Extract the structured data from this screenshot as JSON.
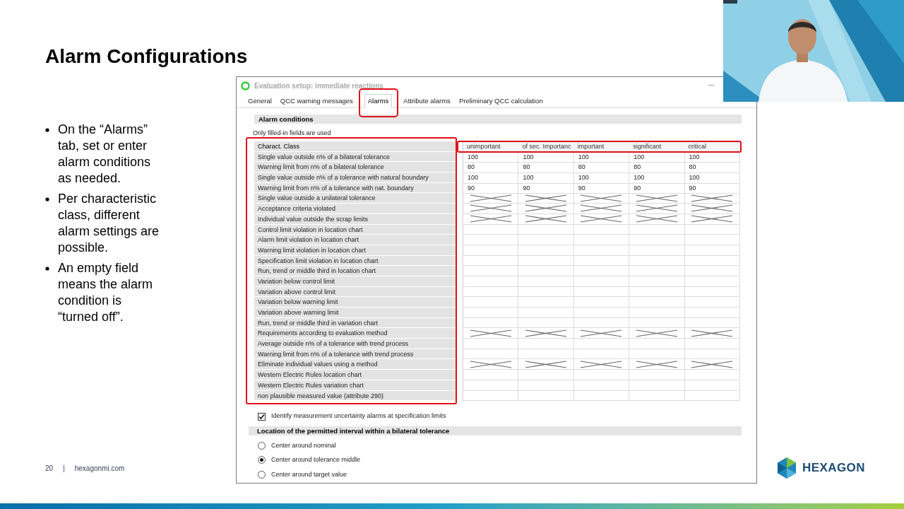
{
  "slide": {
    "title": "Alarm Configurations",
    "bullets": [
      "On the “Alarms” tab, set or enter alarm conditions as needed.",
      "Per characteristic class, different alarm settings are possible.",
      "An empty field means the alarm condition is “turned off”."
    ],
    "page_number": "20",
    "separator": "|",
    "website": "hexagonmi.com",
    "logo_text": "HEXAGON"
  },
  "window": {
    "title": "Evaluation setup: immediate reactions",
    "tabs": [
      {
        "label": "General",
        "selected": false,
        "highlighted": false
      },
      {
        "label": "QCC warning messages",
        "selected": false,
        "highlighted": false
      },
      {
        "label": "Alarms",
        "selected": true,
        "highlighted": true
      },
      {
        "label": "Attribute alarms",
        "selected": false,
        "highlighted": false
      },
      {
        "label": "Preliminary QCC calculation",
        "selected": false,
        "highlighted": false
      }
    ],
    "section_title": "Alarm conditions",
    "note": "Only filled-in fields are used",
    "table": {
      "labels_highlighted": true,
      "header_highlighted": true,
      "corner": "Charact. Class",
      "columns": [
        "unimportant",
        "of sec. Importanc",
        "important",
        "significant",
        "critical"
      ],
      "rows": [
        {
          "label": "Single value outside n% of a bilateral  tolerance",
          "cells": [
            {
              "kind": "value",
              "text": "100"
            },
            {
              "kind": "value",
              "text": "100"
            },
            {
              "kind": "value",
              "text": "100"
            },
            {
              "kind": "value",
              "text": "100"
            },
            {
              "kind": "value",
              "text": "100"
            }
          ]
        },
        {
          "label": "Warning limit from n% of a bilateral tolerance",
          "cells": [
            {
              "kind": "value",
              "text": "80"
            },
            {
              "kind": "value",
              "text": "80"
            },
            {
              "kind": "value",
              "text": "80"
            },
            {
              "kind": "value",
              "text": "80"
            },
            {
              "kind": "value",
              "text": "80"
            }
          ]
        },
        {
          "label": "Single value outside n% of a tolerance with natural boundary",
          "cells": [
            {
              "kind": "value",
              "text": "100"
            },
            {
              "kind": "value",
              "text": "100"
            },
            {
              "kind": "value",
              "text": "100"
            },
            {
              "kind": "value",
              "text": "100"
            },
            {
              "kind": "value",
              "text": "100"
            }
          ]
        },
        {
          "label": "Warning limit from n% of a tolerance with nat. boundary",
          "cells": [
            {
              "kind": "value",
              "text": "90"
            },
            {
              "kind": "value",
              "text": "90"
            },
            {
              "kind": "value",
              "text": "90"
            },
            {
              "kind": "value",
              "text": "90"
            },
            {
              "kind": "value",
              "text": "90"
            }
          ]
        },
        {
          "label": "Single value outside a unilateral tolerance",
          "cells": [
            {
              "kind": "crossed"
            },
            {
              "kind": "crossed"
            },
            {
              "kind": "crossed"
            },
            {
              "kind": "crossed"
            },
            {
              "kind": "crossed"
            }
          ]
        },
        {
          "label": "Acceptance criteria violated",
          "cells": [
            {
              "kind": "crossed"
            },
            {
              "kind": "crossed"
            },
            {
              "kind": "crossed"
            },
            {
              "kind": "crossed"
            },
            {
              "kind": "crossed"
            }
          ]
        },
        {
          "label": "Individual value outside the scrap limits",
          "cells": [
            {
              "kind": "crossed"
            },
            {
              "kind": "crossed"
            },
            {
              "kind": "crossed"
            },
            {
              "kind": "crossed"
            },
            {
              "kind": "crossed"
            }
          ]
        },
        {
          "label": "Control limit violation in location chart",
          "cells": [
            {
              "kind": "empty"
            },
            {
              "kind": "empty"
            },
            {
              "kind": "empty"
            },
            {
              "kind": "empty"
            },
            {
              "kind": "empty"
            }
          ]
        },
        {
          "label": "Alarm limit violation in location chart",
          "cells": [
            {
              "kind": "empty"
            },
            {
              "kind": "empty"
            },
            {
              "kind": "empty"
            },
            {
              "kind": "empty"
            },
            {
              "kind": "empty"
            }
          ]
        },
        {
          "label": "Warning  limit violation in location chart",
          "cells": [
            {
              "kind": "empty"
            },
            {
              "kind": "empty"
            },
            {
              "kind": "empty"
            },
            {
              "kind": "empty"
            },
            {
              "kind": "empty"
            }
          ]
        },
        {
          "label": "Specification limit violation in location chart",
          "cells": [
            {
              "kind": "empty"
            },
            {
              "kind": "empty"
            },
            {
              "kind": "empty"
            },
            {
              "kind": "empty"
            },
            {
              "kind": "empty"
            }
          ]
        },
        {
          "label": "Run, trend or middle third in location chart",
          "cells": [
            {
              "kind": "empty"
            },
            {
              "kind": "empty"
            },
            {
              "kind": "empty"
            },
            {
              "kind": "empty"
            },
            {
              "kind": "empty"
            }
          ]
        },
        {
          "label": "Variation below control limit",
          "cells": [
            {
              "kind": "empty"
            },
            {
              "kind": "empty"
            },
            {
              "kind": "empty"
            },
            {
              "kind": "empty"
            },
            {
              "kind": "empty"
            }
          ]
        },
        {
          "label": "Variation above control limit",
          "cells": [
            {
              "kind": "empty"
            },
            {
              "kind": "empty"
            },
            {
              "kind": "empty"
            },
            {
              "kind": "empty"
            },
            {
              "kind": "empty"
            }
          ]
        },
        {
          "label": "Variation below warning limit",
          "cells": [
            {
              "kind": "empty"
            },
            {
              "kind": "empty"
            },
            {
              "kind": "empty"
            },
            {
              "kind": "empty"
            },
            {
              "kind": "empty"
            }
          ]
        },
        {
          "label": "Variation above warning limit",
          "cells": [
            {
              "kind": "empty"
            },
            {
              "kind": "empty"
            },
            {
              "kind": "empty"
            },
            {
              "kind": "empty"
            },
            {
              "kind": "empty"
            }
          ]
        },
        {
          "label": "Run, trend or middle third in variation chart",
          "cells": [
            {
              "kind": "empty"
            },
            {
              "kind": "empty"
            },
            {
              "kind": "empty"
            },
            {
              "kind": "empty"
            },
            {
              "kind": "empty"
            }
          ]
        },
        {
          "label": "Requirements according to evaluation method",
          "cells": [
            {
              "kind": "crossed"
            },
            {
              "kind": "crossed"
            },
            {
              "kind": "crossed"
            },
            {
              "kind": "crossed"
            },
            {
              "kind": "crossed"
            }
          ]
        },
        {
          "label": "Average outside n% of a tolerance with trend process",
          "cells": [
            {
              "kind": "empty"
            },
            {
              "kind": "empty"
            },
            {
              "kind": "empty"
            },
            {
              "kind": "empty"
            },
            {
              "kind": "empty"
            }
          ]
        },
        {
          "label": "Warning limit from n% of a tolerance with trend process",
          "cells": [
            {
              "kind": "empty"
            },
            {
              "kind": "empty"
            },
            {
              "kind": "empty"
            },
            {
              "kind": "empty"
            },
            {
              "kind": "empty"
            }
          ]
        },
        {
          "label": "Eliminate individual values using a method",
          "cells": [
            {
              "kind": "crossed"
            },
            {
              "kind": "crossed"
            },
            {
              "kind": "crossed"
            },
            {
              "kind": "crossed"
            },
            {
              "kind": "crossed"
            }
          ]
        },
        {
          "label": "Western Electric Rules location chart",
          "cells": [
            {
              "kind": "empty"
            },
            {
              "kind": "empty"
            },
            {
              "kind": "empty"
            },
            {
              "kind": "empty"
            },
            {
              "kind": "empty"
            }
          ]
        },
        {
          "label": "Western Electric Rules variation chart",
          "cells": [
            {
              "kind": "empty"
            },
            {
              "kind": "empty"
            },
            {
              "kind": "empty"
            },
            {
              "kind": "empty"
            },
            {
              "kind": "empty"
            }
          ]
        },
        {
          "label": "non plausible measured value (attribute 290)",
          "cells": [
            {
              "kind": "empty"
            },
            {
              "kind": "empty"
            },
            {
              "kind": "empty"
            },
            {
              "kind": "empty"
            },
            {
              "kind": "empty"
            }
          ]
        }
      ]
    },
    "checkbox": {
      "label": "Identify measurement uncertainty alarms at specification limits",
      "checked": true
    },
    "interval_section_title": "Location of the permitted interval within a bilateral tolerance",
    "interval_options": [
      {
        "label": "Center around nominal",
        "selected": false
      },
      {
        "label": "Center around tolerance middle",
        "selected": true
      },
      {
        "label": "Center around target value",
        "selected": false
      }
    ]
  }
}
